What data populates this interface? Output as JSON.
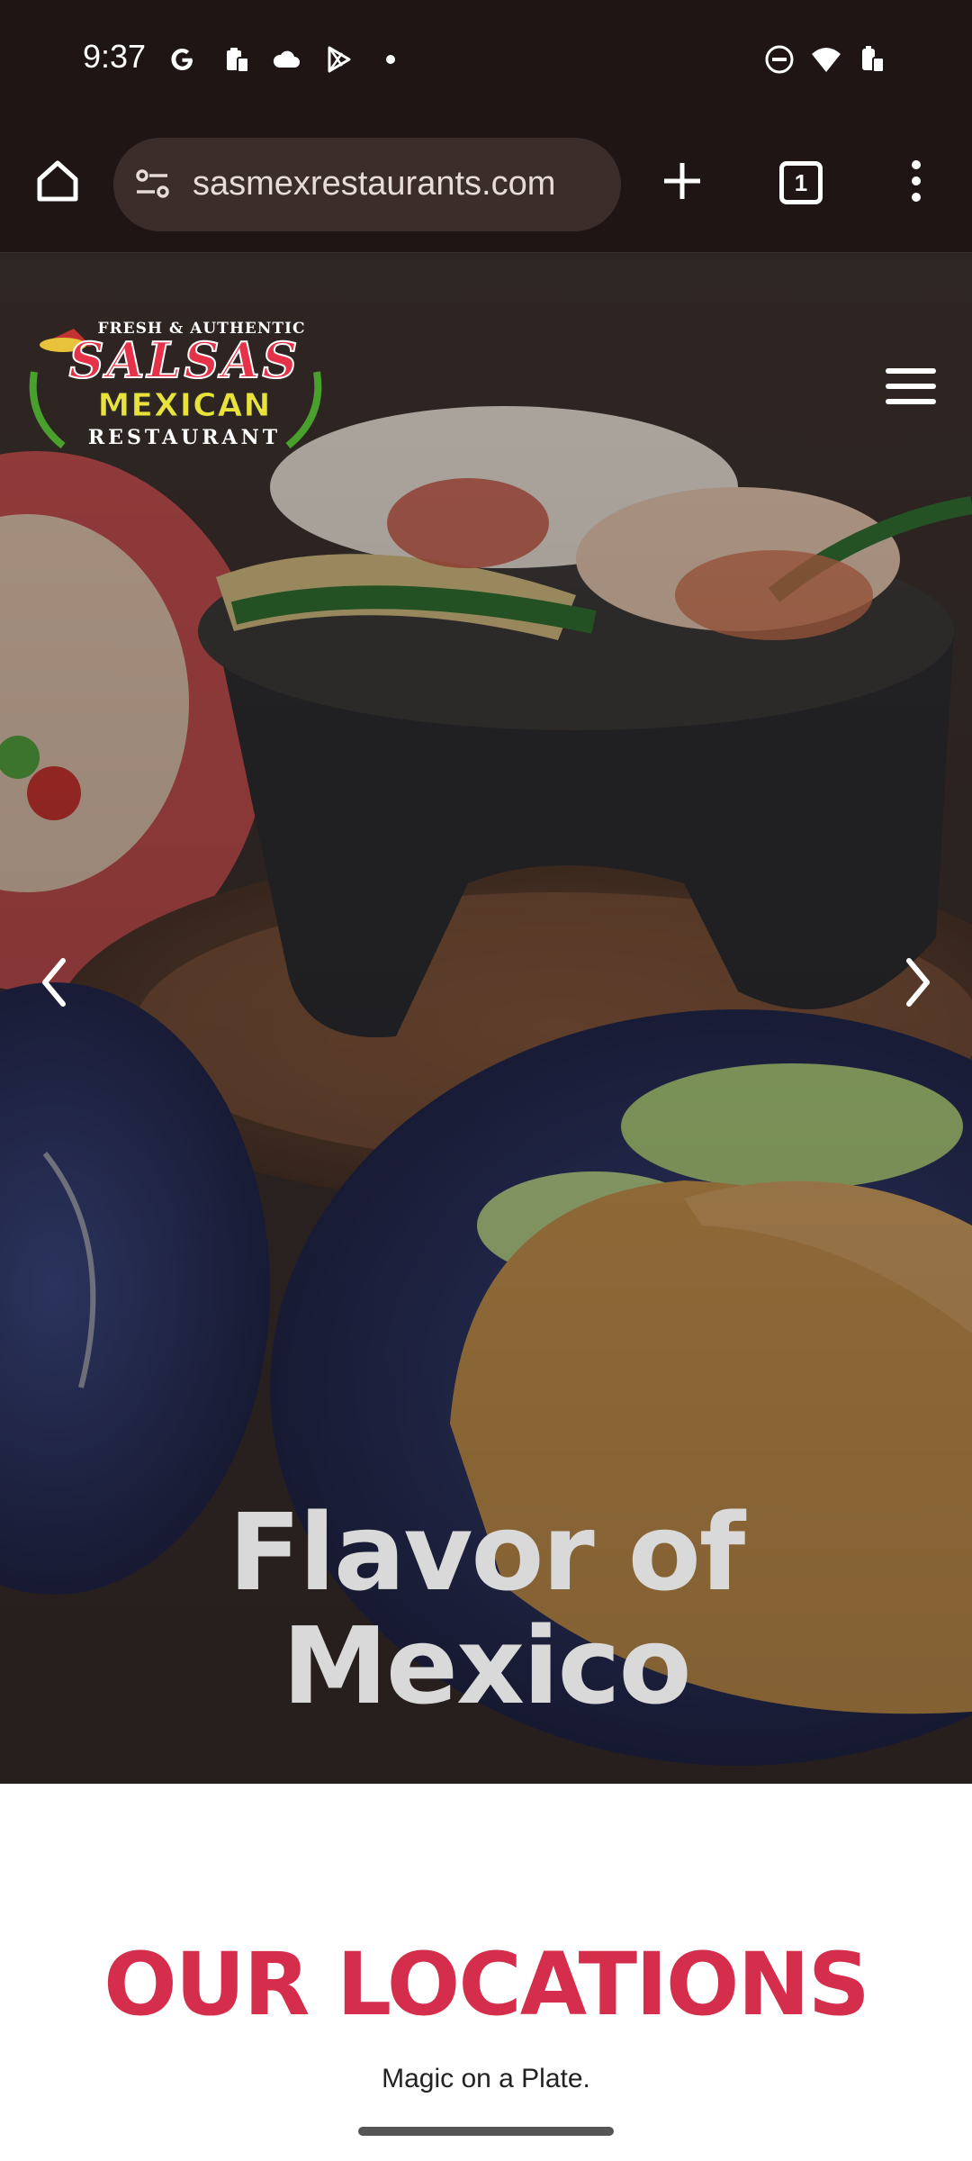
{
  "status_bar": {
    "time": "9:37",
    "left_icons": [
      "google-icon",
      "clipboard-icon",
      "cloud-icon",
      "play-store-icon",
      "notification-dot"
    ],
    "right_icons": [
      "do-not-disturb-icon",
      "wifi-icon",
      "battery-icon"
    ]
  },
  "browser": {
    "url": "sasmexrestaurants.com",
    "tab_count": "1",
    "icons": [
      "home-icon",
      "site-settings-icon",
      "new-tab-icon",
      "tab-switcher-icon",
      "more-options-icon"
    ]
  },
  "hero": {
    "logo": {
      "line1": "FRESH & AUTHENTIC",
      "line2": "SALSAS",
      "line3": "MEXICAN",
      "line4": "RESTAURANT"
    },
    "title_line1": "Flavor of",
    "title_line2": "Mexico",
    "icons": [
      "hamburger-menu-icon",
      "chevron-left-icon",
      "chevron-right-icon"
    ]
  },
  "locations": {
    "title": "OUR LOCATIONS",
    "tagline": "Magic on a Plate."
  },
  "colors": {
    "status_bg": "#1f1515",
    "accent_red": "#d42e4c",
    "logo_yellow": "#e8e23a",
    "logo_green": "#4aa02c"
  }
}
